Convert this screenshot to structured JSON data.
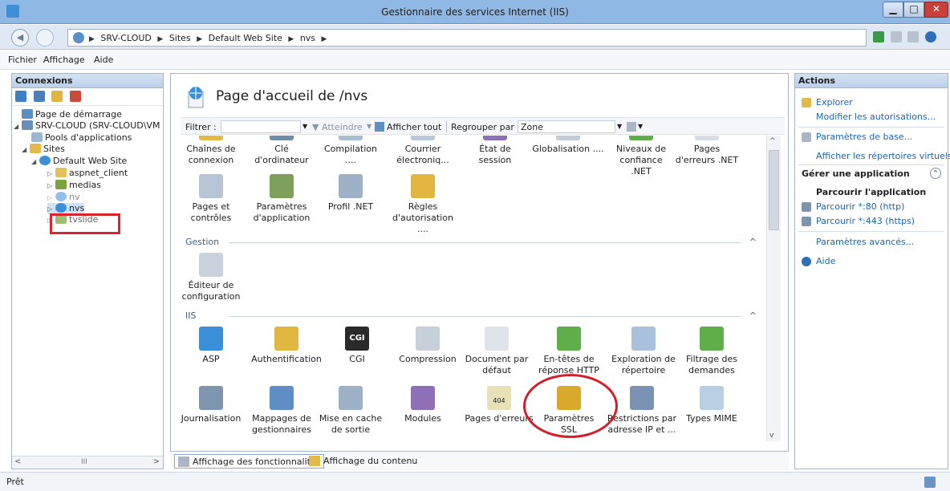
{
  "window": {
    "title": "Gestionnaire des services Internet (IIS)"
  },
  "address": {
    "crumbs": [
      "SRV-CLOUD",
      "Sites",
      "Default Web Site",
      "nvs"
    ]
  },
  "menu": {
    "items": [
      "Fichier",
      "Affichage",
      "Aide"
    ]
  },
  "connections": {
    "header": "Connexions",
    "tree": {
      "start": "Page de démarrage",
      "server": "SRV-CLOUD (SRV-CLOUD\\VM",
      "pools": "Pools d'applications",
      "sites": "Sites",
      "default_site": "Default Web Site",
      "aspnet": "aspnet_client",
      "medias": "medias",
      "nv": "nv",
      "nvs": "nvs",
      "tvslide": "tvslide"
    },
    "scroll_mid": "III"
  },
  "main": {
    "title": "Page d'accueil de /nvs",
    "filter_label": "Filtrer :",
    "goto_label": "Atteindre",
    "show_all_label": "Afficher tout",
    "group_label": "Regrouper par :",
    "group_value": "Zone",
    "row1": [
      {
        "label": "Chaînes de connexion"
      },
      {
        "label": "Clé d'ordinateur"
      },
      {
        "label": "Compilation ...."
      },
      {
        "label": "Courrier électroniq..."
      },
      {
        "label": "État de session"
      },
      {
        "label": "Globalisation ...."
      },
      {
        "label": "Niveaux de confiance .NET"
      },
      {
        "label": "Pages d'erreurs .NET"
      }
    ],
    "row2": [
      {
        "label": "Pages et contrôles"
      },
      {
        "label": "Paramètres d'application"
      },
      {
        "label": "Profil .NET"
      },
      {
        "label": "Règles d'autorisation ...."
      }
    ],
    "section_gestion": "Gestion",
    "gestion_items": [
      {
        "label": "Éditeur de configuration"
      }
    ],
    "section_iis": "IIS",
    "iis_row1": [
      {
        "label": "ASP"
      },
      {
        "label": "Authentification"
      },
      {
        "label": "CGI"
      },
      {
        "label": "Compression"
      },
      {
        "label": "Document par défaut"
      },
      {
        "label": "En-têtes de réponse HTTP"
      },
      {
        "label": "Exploration de répertoire"
      },
      {
        "label": "Filtrage des demandes"
      }
    ],
    "iis_row2": [
      {
        "label": "Journalisation"
      },
      {
        "label": "Mappages de gestionnaires"
      },
      {
        "label": "Mise en cache de sortie"
      },
      {
        "label": "Modules"
      },
      {
        "label": "Pages d'erreurs"
      },
      {
        "label": "Paramètres SSL"
      },
      {
        "label": "Restrictions par adresse IP et ..."
      },
      {
        "label": "Types MIME"
      }
    ],
    "icon_texts": {
      "cgi": "CGI",
      "error_404": "404"
    }
  },
  "tabs": {
    "features": "Affichage des fonctionnalités",
    "content": "Affichage du contenu"
  },
  "actions": {
    "header": "Actions",
    "explore": "Explorer",
    "edit_perms": "Modifier les autorisations...",
    "basic_settings": "Paramètres de base...",
    "show_vdirs": "Afficher les répertoires virtuels",
    "manage_app_header": "Gérer une application",
    "browse_app": "Parcourir l'application",
    "browse_80": "Parcourir *:80 (http)",
    "browse_443": "Parcourir *:443 (https)",
    "advanced": "Paramètres avancés...",
    "help": "Aide"
  },
  "status": {
    "text": "Prêt"
  }
}
